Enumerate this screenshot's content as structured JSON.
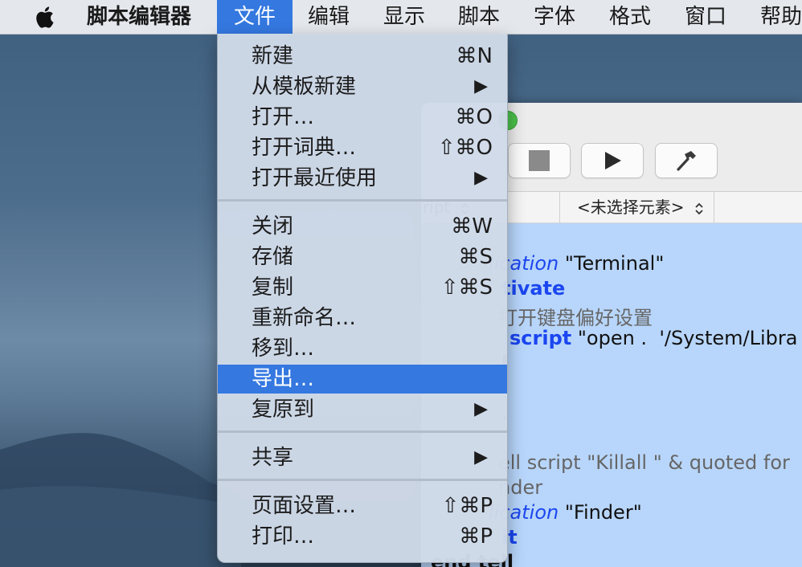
{
  "menubar": {
    "app_name": "脚本编辑器",
    "items": [
      "文件",
      "编辑",
      "显示",
      "脚本",
      "字体",
      "格式",
      "窗口",
      "帮助"
    ]
  },
  "file_menu": {
    "groups": [
      [
        {
          "label": "新建",
          "shortcut": "⌘N"
        },
        {
          "label": "从模板新建",
          "shortcut": "▶"
        },
        {
          "label": "打开…",
          "shortcut": "⌘O"
        },
        {
          "label": "打开词典…",
          "shortcut": "⇧⌘O"
        },
        {
          "label": "打开最近使用",
          "shortcut": "▶"
        }
      ],
      [
        {
          "label": "关闭",
          "shortcut": "⌘W"
        },
        {
          "label": "存储",
          "shortcut": "⌘S"
        },
        {
          "label": "复制",
          "shortcut": "⇧⌘S"
        },
        {
          "label": "重新命名…",
          "shortcut": ""
        },
        {
          "label": "移到…",
          "shortcut": ""
        },
        {
          "label": "导出…",
          "shortcut": "",
          "highlighted": true
        },
        {
          "label": "复原到",
          "shortcut": "▶"
        }
      ],
      [
        {
          "label": "共享",
          "shortcut": "▶"
        }
      ],
      [
        {
          "label": "页面设置…",
          "shortcut": "⇧⌘P"
        },
        {
          "label": "打印…",
          "shortcut": "⌘P"
        }
      ]
    ]
  },
  "editor": {
    "nav_language": "ript",
    "nav_element": "<未选择元素>",
    "code_lines": [
      {
        "parts": [
          [
            "kw-i",
            "lication"
          ],
          [
            "",
            " \"Terminal\""
          ]
        ]
      },
      {
        "parts": [
          [
            "kw-b",
            "tivate"
          ]
        ]
      },
      {
        "parts": [
          [
            "cmt",
            "打开键盘偏好设置"
          ]
        ]
      },
      {
        "parts": [
          [
            "kw-b",
            "script"
          ],
          [
            "",
            " \"open .  '/System/Libra"
          ]
        ]
      },
      {
        "parts": [
          [
            "dark-b",
            "l"
          ]
        ]
      },
      {
        "parts": [
          [
            "",
            ""
          ]
        ]
      },
      {
        "parts": [
          [
            "",
            "."
          ]
        ]
      },
      {
        "parts": [
          [
            "",
            ""
          ]
        ]
      },
      {
        "parts": [
          [
            "cmt",
            "ell script \"Killall \" & quoted for"
          ]
        ]
      },
      {
        "parts": [
          [
            "cmt",
            "nder"
          ]
        ]
      },
      {
        "parts": [
          [
            "kw-i",
            "lication"
          ],
          [
            "",
            " \"Finder\""
          ]
        ]
      },
      {
        "parts": [
          [
            "kw-b",
            "it"
          ]
        ]
      },
      {
        "parts": [
          [
            "dark-b",
            "end tell"
          ]
        ]
      }
    ]
  },
  "colors": {
    "menu_highlight": "#3478e0",
    "code_background": "#b8d6fb",
    "keyword_blue": "#1b46f0"
  }
}
